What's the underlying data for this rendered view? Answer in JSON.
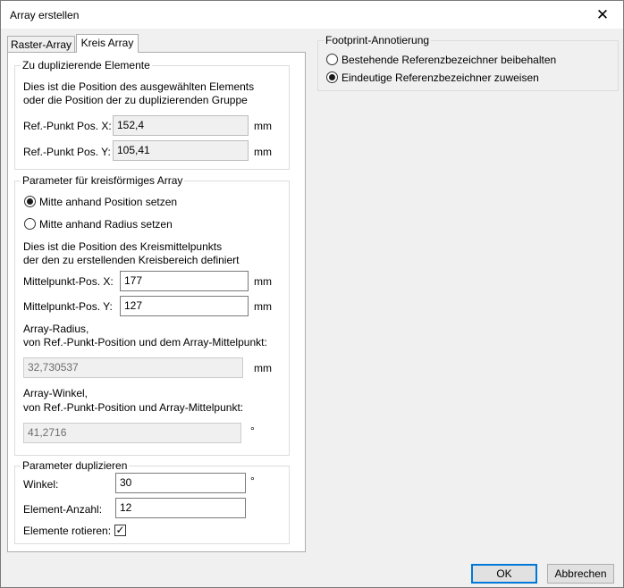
{
  "window": {
    "title": "Array erstellen"
  },
  "tabs": [
    {
      "label": "Raster-Array"
    },
    {
      "label": "Kreis Array"
    }
  ],
  "dup_elements": {
    "legend": "Zu duplizierende Elemente",
    "description_line1": "Dies ist die Position des ausgewählten Elements",
    "description_line2": "oder die Position der zu duplizierenden Gruppe",
    "ref_x_label": "Ref.-Punkt Pos. X:",
    "ref_x_value": "152,4",
    "ref_y_label": "Ref.-Punkt Pos. Y:",
    "ref_y_value": "105,41",
    "unit": "mm"
  },
  "circular": {
    "legend": "Parameter für kreisförmiges Array",
    "radio_position": "Mitte anhand Position setzen",
    "radio_radius": "Mitte anhand Radius setzen",
    "description_line1": "Dies ist die Position des Kreismittelpunkts",
    "description_line2": "der den zu erstellenden Kreisbereich definiert",
    "center_x_label": "Mittelpunkt-Pos. X:",
    "center_x_value": "177",
    "center_y_label": "Mittelpunkt-Pos. Y:",
    "center_y_value": "127",
    "unit": "mm",
    "radius_label_line1": "Array-Radius,",
    "radius_label_line2": "von Ref.-Punkt-Position und dem Array-Mittelpunkt:",
    "radius_value": "32,730537",
    "angle_label_line1": "Array-Winkel,",
    "angle_label_line2": "von Ref.-Punkt-Position und Array-Mittelpunkt:",
    "angle_value": "41,2716",
    "degree_unit": "°"
  },
  "duplicate": {
    "legend": "Parameter duplizieren",
    "angle_label": "Winkel:",
    "angle_value": "30",
    "degree_unit": "°",
    "count_label": "Element-Anzahl:",
    "count_value": "12",
    "rotate_label": "Elemente rotieren:",
    "rotate_check": "✓"
  },
  "footprint": {
    "legend": "Footprint-Annotierung",
    "radio_keep": "Bestehende Referenzbezeichner beibehalten",
    "radio_unique": "Eindeutige Referenzbezeichner zuweisen"
  },
  "buttons": {
    "ok": "OK",
    "cancel": "Abbrechen"
  },
  "icons": {
    "close": "✕"
  }
}
